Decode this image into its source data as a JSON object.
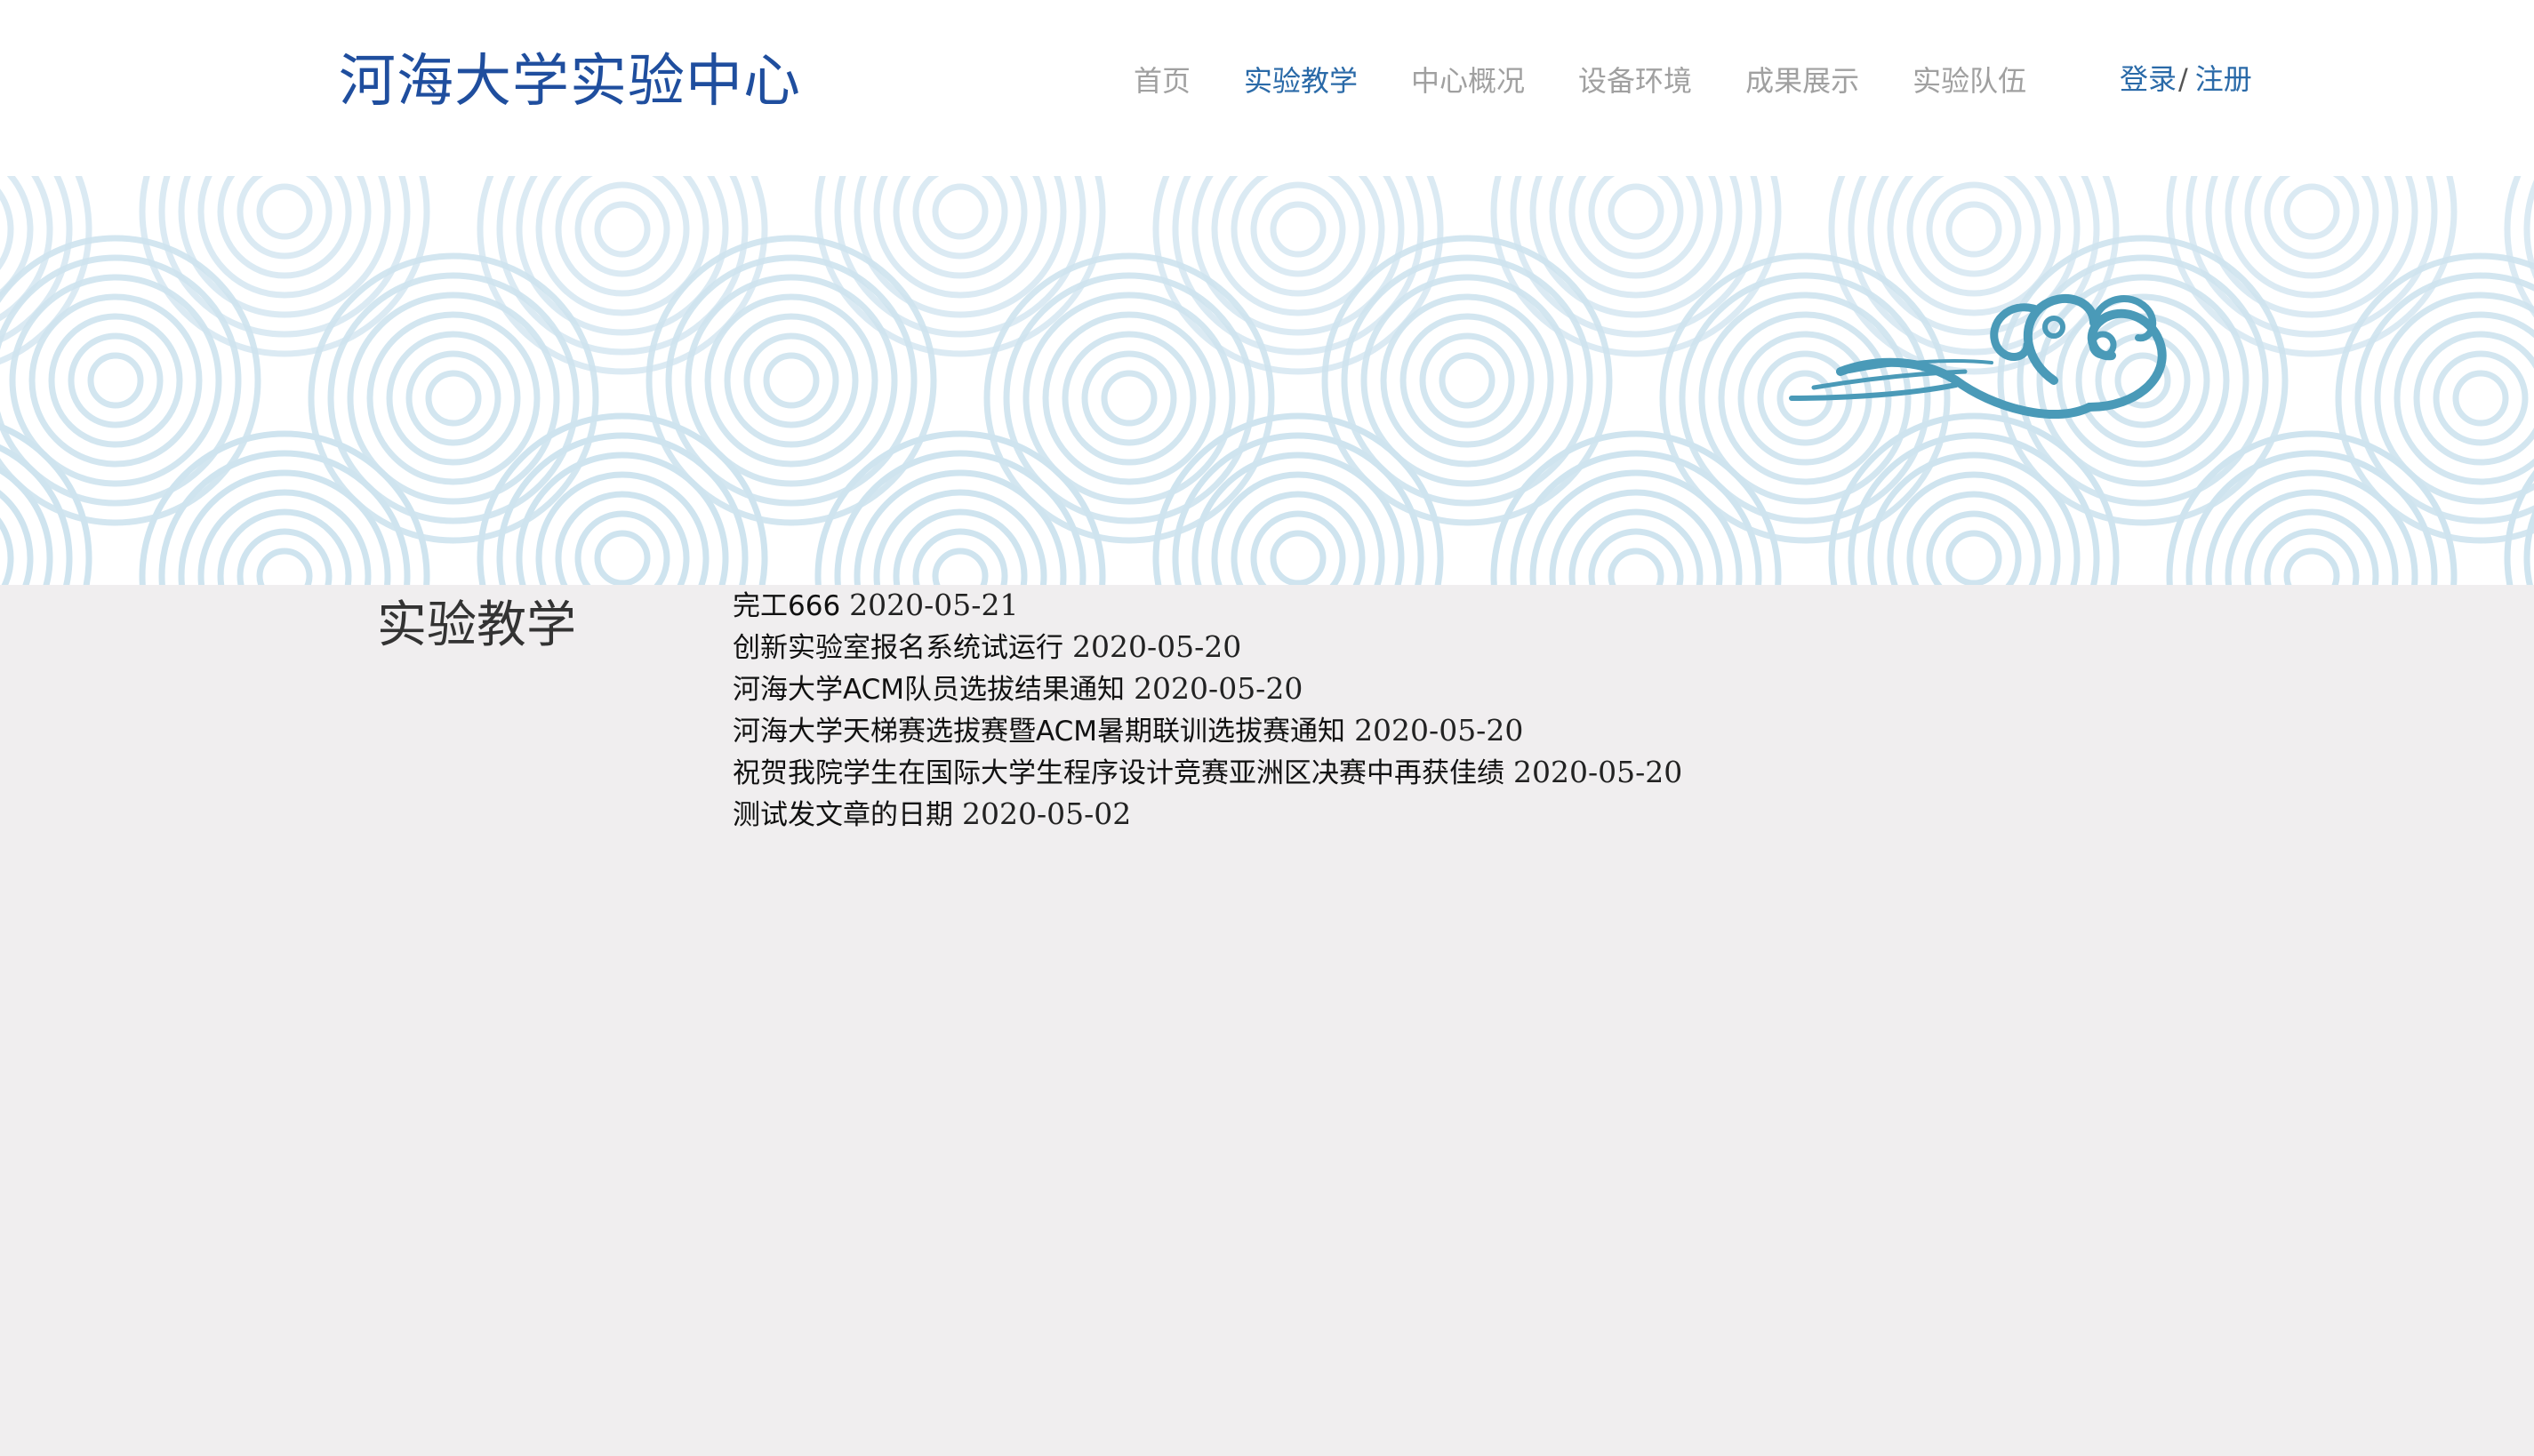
{
  "site": {
    "title": "河海大学实验中心"
  },
  "nav": {
    "items": [
      {
        "label": "首页",
        "active": false
      },
      {
        "label": "实验教学",
        "active": true
      },
      {
        "label": "中心概况",
        "active": false
      },
      {
        "label": "设备环境",
        "active": false
      },
      {
        "label": "成果展示",
        "active": false
      },
      {
        "label": "实验队伍",
        "active": false
      }
    ],
    "active_color": "#2a6aa8",
    "inactive_color": "#a0a0a0"
  },
  "auth": {
    "login_label": "登录",
    "separator": "/",
    "register_label": "注册"
  },
  "banner": {
    "pattern": "wave-pattern",
    "emblem_icon": "cloud-swirl-icon",
    "wave_color": "#cfe4ef",
    "emblem_color": "#4a9ab8"
  },
  "section": {
    "title": "实验教学"
  },
  "articles": [
    {
      "title": "完工666",
      "date": "2020-05-21"
    },
    {
      "title": "创新实验室报名系统试运行",
      "date": "2020-05-20"
    },
    {
      "title": "河海大学ACM队员选拔结果通知",
      "date": "2020-05-20"
    },
    {
      "title": "河海大学天梯赛选拔赛暨ACM暑期联训选拔赛通知",
      "date": "2020-05-20"
    },
    {
      "title": "祝贺我院学生在国际大学生程序设计竞赛亚洲区决赛中再获佳绩",
      "date": "2020-05-20"
    },
    {
      "title": "测试发文章的日期",
      "date": "2020-05-02"
    }
  ],
  "colors": {
    "brand": "#1f4e9e",
    "page_background": "#f0eeef"
  }
}
